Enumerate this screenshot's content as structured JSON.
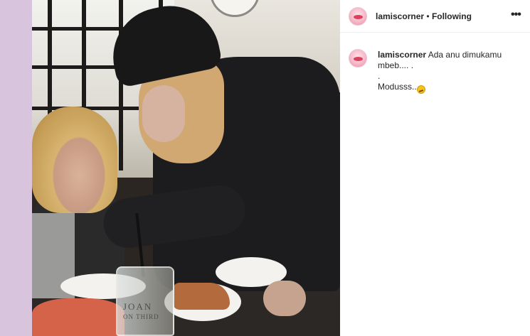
{
  "header": {
    "username": "lamiscorner",
    "separator": "•",
    "follow_status": "Following",
    "more_icon": "more-horizontal-icon",
    "more_glyph": "•••"
  },
  "caption": {
    "username": "lamiscorner",
    "line1": "Ada anu dimukamu",
    "line2": "mbeb.... .",
    "line3": ".",
    "line4": "Modusss..",
    "emoji": "grimacing-face-emoji"
  },
  "media": {
    "cup_text_1": "JOAN",
    "cup_text_2": "ON THIRD"
  },
  "colors": {
    "backdrop": "#d8c4dd",
    "panel": "#ffffff",
    "text": "#262626",
    "divider": "#efefef"
  }
}
